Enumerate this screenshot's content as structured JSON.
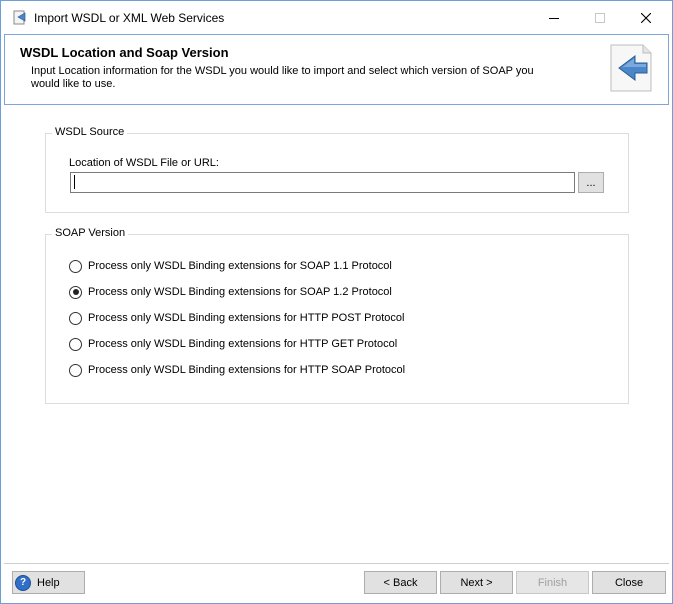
{
  "window": {
    "title": "Import WSDL or XML Web Services"
  },
  "banner": {
    "title": "WSDL Location and Soap Version",
    "description": "Input Location information for the WSDL you would like to import and select which version of SOAP you would like to use."
  },
  "wsdl_source": {
    "group_label": "WSDL Source",
    "field_label": "Location of WSDL File or URL:",
    "value": "",
    "browse_label": "..."
  },
  "soap_version": {
    "group_label": "SOAP Version",
    "options": [
      {
        "label": "Process only WSDL Binding extensions for SOAP 1.1 Protocol",
        "checked": false
      },
      {
        "label": "Process only WSDL Binding extensions for SOAP 1.2 Protocol",
        "checked": true
      },
      {
        "label": "Process only WSDL Binding extensions for HTTP POST Protocol",
        "checked": false
      },
      {
        "label": "Process only WSDL Binding extensions for HTTP GET Protocol",
        "checked": false
      },
      {
        "label": "Process only WSDL Binding extensions for HTTP SOAP Protocol",
        "checked": false
      }
    ]
  },
  "buttons": {
    "help": "Help",
    "back": "< Back",
    "next": "Next >",
    "finish": "Finish",
    "close": "Close"
  },
  "colors": {
    "window_border": "#6d9ed6",
    "help_icon": "#2f6fc6",
    "banner_arrow": "#4a86c8"
  },
  "icons": {
    "app": "import-wsdl-icon",
    "banner": "back-arrow-icon",
    "help": "help-icon"
  }
}
